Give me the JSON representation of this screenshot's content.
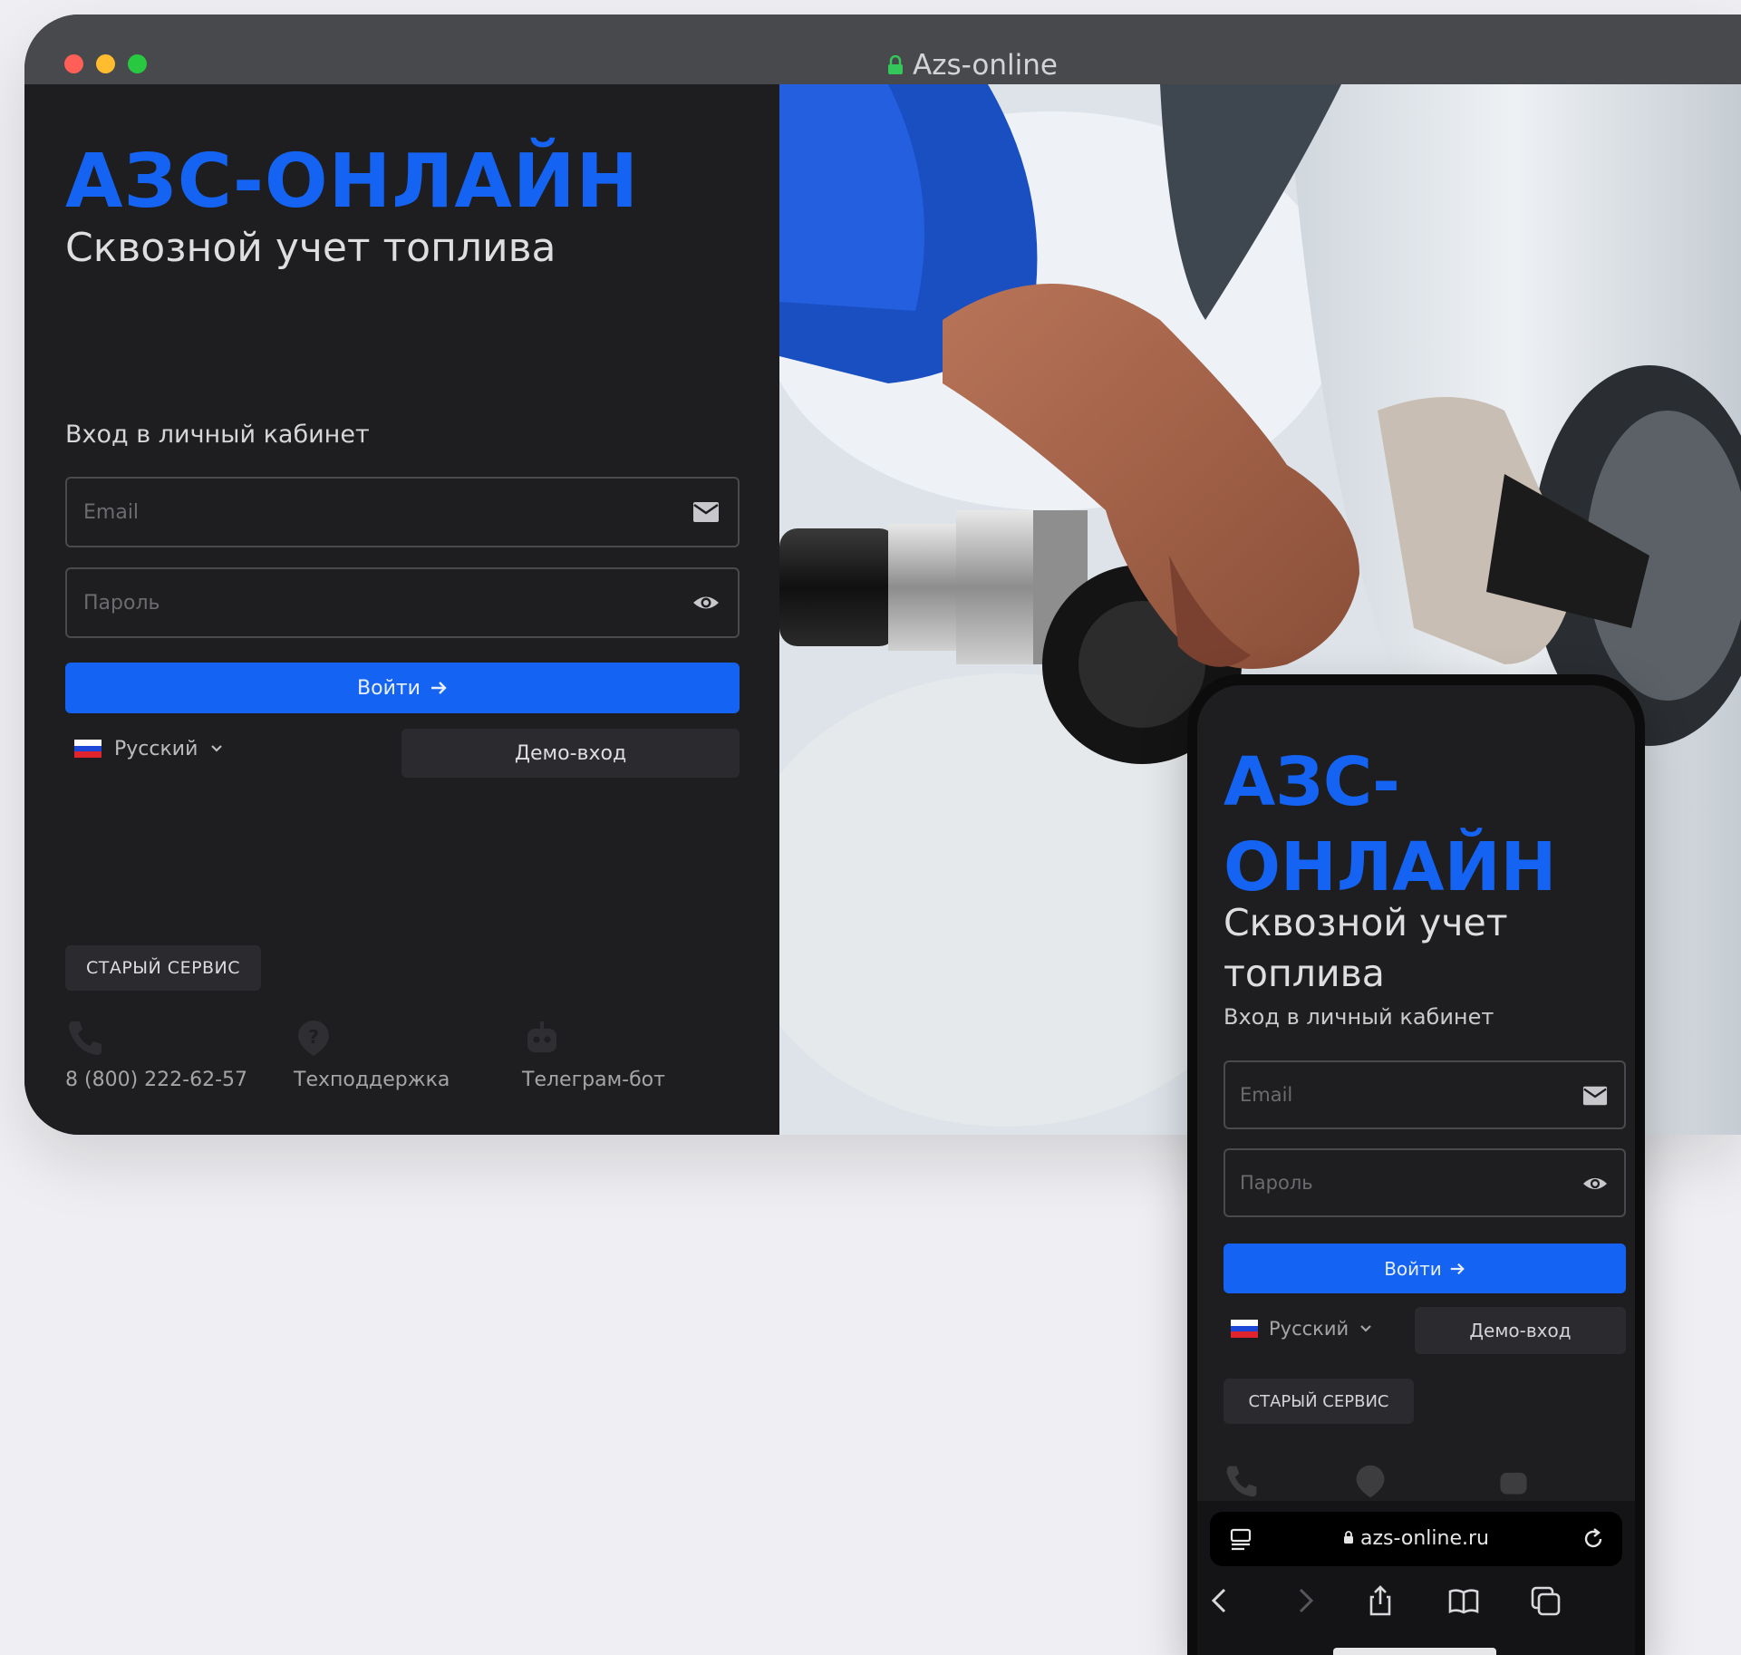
{
  "desktop": {
    "window_title": "Azs-online",
    "brand": "АЗС-ОНЛАЙН",
    "tagline": "Сквозной учет топлива",
    "login_heading": "Вход в личный кабинет",
    "email_placeholder": "Email",
    "password_placeholder": "Пароль",
    "login_button": "Войти",
    "language": "Русский",
    "demo_button": "Демо-вход",
    "old_service_button": "СТАРЫЙ СЕРВИС",
    "contacts": [
      {
        "label": "8 (800) 222-62-57",
        "icon": "phone-icon"
      },
      {
        "label": "Техподдержка",
        "icon": "support-icon"
      },
      {
        "label": "Телеграм-бот",
        "icon": "telegram-bot-icon"
      }
    ]
  },
  "mobile": {
    "brand": "АЗС-ОНЛАЙН",
    "tagline": "Сквозной учет топлива",
    "login_heading": "Вход в личный кабинет",
    "email_placeholder": "Email",
    "password_placeholder": "Пароль",
    "login_button": "Войти",
    "language": "Русский",
    "demo_button": "Демо-вход",
    "old_service_button": "СТАРЫЙ СЕРВИС",
    "url": "azs-online.ru"
  },
  "colors": {
    "accent": "#1463f3",
    "panel": "#1e1e20",
    "titlebar": "#48494c",
    "secondary_button": "#2b2b2f"
  }
}
